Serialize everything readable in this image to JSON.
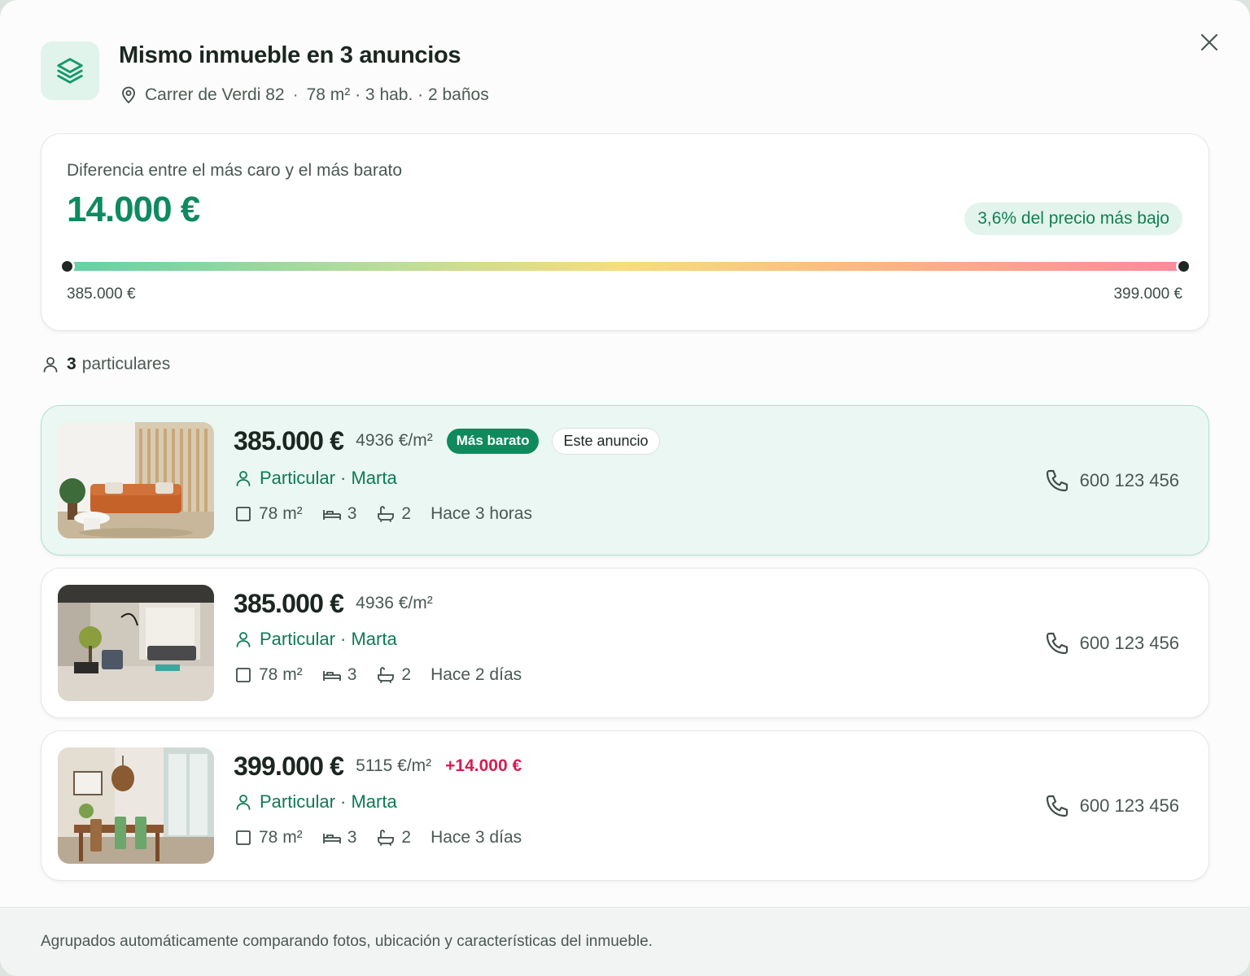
{
  "header": {
    "title": "Mismo inmueble en 3 anuncios",
    "address": "Carrer de Verdi 82",
    "separator": "·",
    "details": "78 m² · 3 hab. · 2 baños"
  },
  "summary": {
    "label": "Diferencia entre el más caro y el más barato",
    "difference": "14.000 €",
    "badge": "3,6% del precio más bajo",
    "min_price": "385.000 €",
    "max_price": "399.000 €"
  },
  "sellers": {
    "count": "3",
    "label": "particulares"
  },
  "listings": [
    {
      "price": "385.000 €",
      "price_per_m2": "4936 €/m²",
      "badge_cheapest": "Más barato",
      "badge_this": "Este anuncio",
      "seller": "Particular · Marta",
      "area": "78 m²",
      "bedrooms": "3",
      "bathrooms": "2",
      "posted": "Hace 3 horas",
      "phone": "600 123 456"
    },
    {
      "price": "385.000 €",
      "price_per_m2": "4936 €/m²",
      "seller": "Particular · Marta",
      "area": "78 m²",
      "bedrooms": "3",
      "bathrooms": "2",
      "posted": "Hace 2 días",
      "phone": "600 123 456"
    },
    {
      "price": "399.000 €",
      "price_per_m2": "5115 €/m²",
      "price_diff": "+14.000 €",
      "seller": "Particular · Marta",
      "area": "78 m²",
      "bedrooms": "3",
      "bathrooms": "2",
      "posted": "Hace 3 días",
      "phone": "600 123 456"
    }
  ],
  "footer": {
    "note": "Agrupados automáticamente comparando fotos, ubicación y características del inmueble."
  },
  "colors": {
    "accent": "#0e8a5f",
    "accent_light": "#e2f4ec",
    "highlight_bg": "#ebf7f3",
    "price_up": "#d51e52",
    "text_dark": "#1b2620"
  },
  "icons": [
    "layers-icon",
    "map-pin-icon",
    "close-icon",
    "person-icon",
    "area-square-icon",
    "bed-icon",
    "bath-icon",
    "phone-icon"
  ]
}
